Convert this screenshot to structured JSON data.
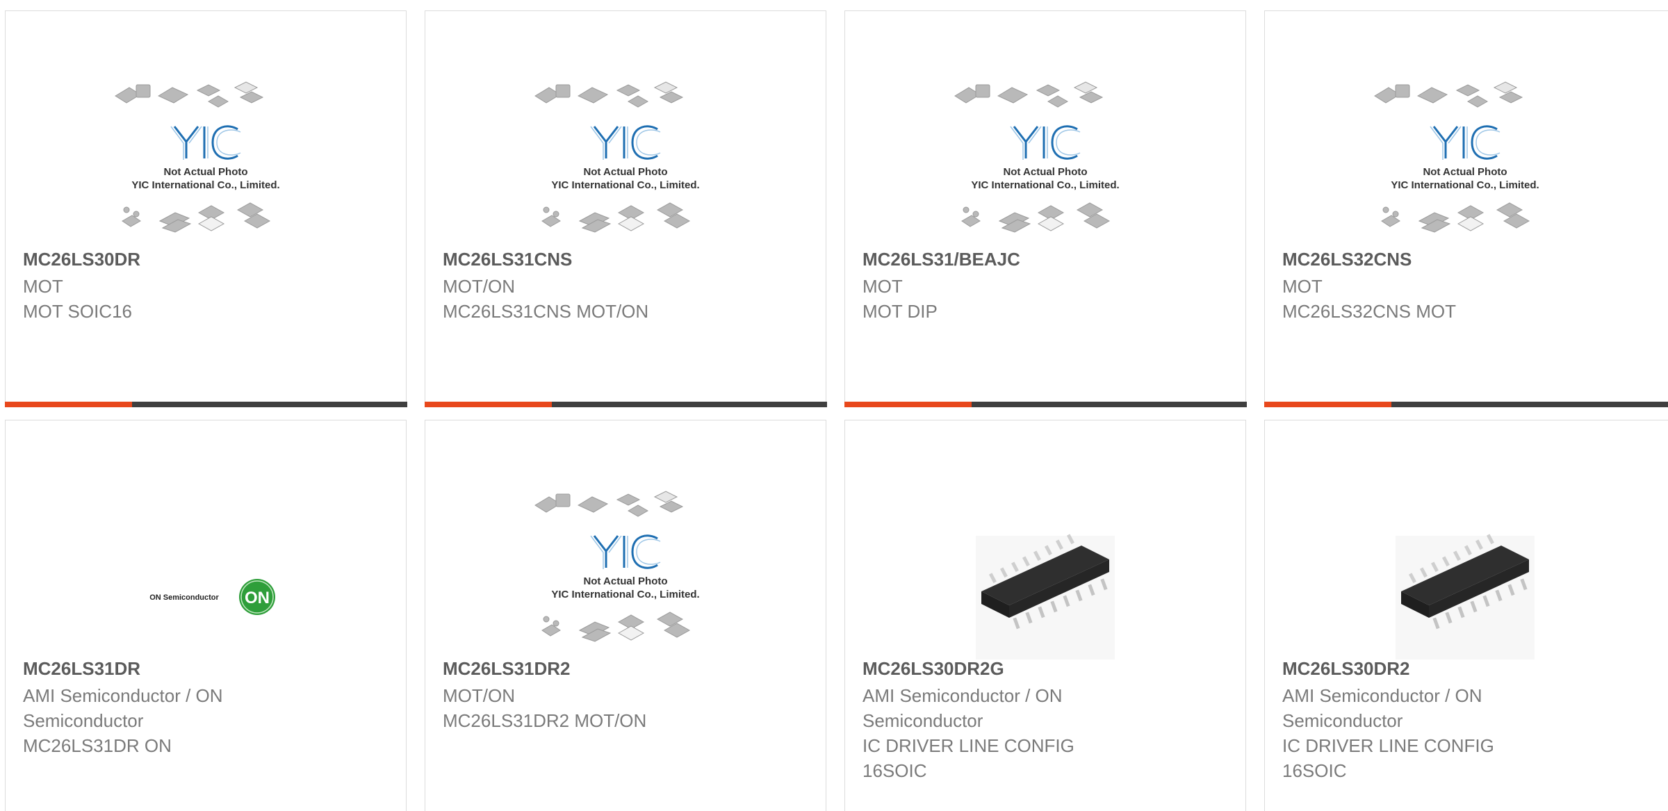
{
  "placeholder": {
    "caption_line1": "Not Actual Photo",
    "caption_line2": "YIC International Co., Limited.",
    "logo_text": "YIC"
  },
  "on_logo": {
    "brand_text": "ON Semiconductor",
    "badge_text": "ON"
  },
  "colors": {
    "accent": "#e8481c",
    "bar": "#3f3f3f",
    "title": "#5b5b5b",
    "text": "#7a7a7a",
    "yic_blue": "#1f6fb2"
  },
  "products": [
    {
      "part_number": "MC26LS30DR",
      "lines": [
        "MOT",
        "MOT SOIC16"
      ],
      "image": "yic-placeholder"
    },
    {
      "part_number": "MC26LS31CNS",
      "lines": [
        "MOT/ON",
        "MC26LS31CNS MOT/ON"
      ],
      "image": "yic-placeholder"
    },
    {
      "part_number": "MC26LS31/BEAJC",
      "lines": [
        "MOT",
        "MOT DIP"
      ],
      "image": "yic-placeholder"
    },
    {
      "part_number": "MC26LS32CNS",
      "lines": [
        "MOT",
        "MC26LS32CNS MOT"
      ],
      "image": "yic-placeholder"
    },
    {
      "part_number": "MC26LS31DR",
      "lines": [
        "AMI Semiconductor / ON",
        "Semiconductor",
        "MC26LS31DR ON"
      ],
      "image": "on-semiconductor-logo"
    },
    {
      "part_number": "MC26LS31DR2",
      "lines": [
        "MOT/ON",
        "MC26LS31DR2 MOT/ON"
      ],
      "image": "yic-placeholder"
    },
    {
      "part_number": "MC26LS30DR2G",
      "lines": [
        "AMI Semiconductor / ON",
        "Semiconductor",
        "IC DRIVER LINE CONFIG",
        "16SOIC"
      ],
      "image": "soic16-chip"
    },
    {
      "part_number": "MC26LS30DR2",
      "lines": [
        "AMI Semiconductor / ON",
        "Semiconductor",
        "IC DRIVER LINE CONFIG",
        "16SOIC"
      ],
      "image": "soic16-chip"
    }
  ]
}
